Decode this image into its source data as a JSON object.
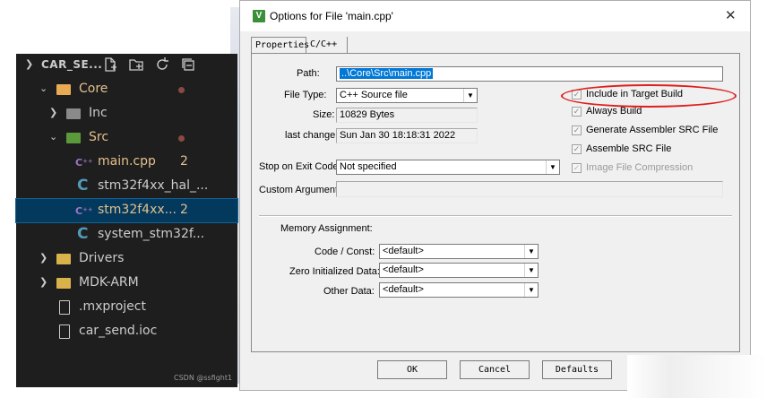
{
  "explorer": {
    "header_title": "CAR_SE...",
    "toolbar_icons": [
      "new-file-icon",
      "new-folder-icon",
      "refresh-icon",
      "collapse-all-icon"
    ],
    "items": [
      {
        "label": "Core",
        "type": "folder",
        "expanded": true,
        "depth": 1,
        "color": "#e8ab53"
      },
      {
        "label": "Inc",
        "type": "folder",
        "expanded": false,
        "depth": 2,
        "color": "#8a8a8a"
      },
      {
        "label": "Src",
        "type": "folder",
        "expanded": true,
        "depth": 2,
        "color": "#5b9a3a"
      },
      {
        "label": "main.cpp",
        "type": "cpp",
        "badge": "2",
        "depth": 3
      },
      {
        "label": "stm32f4xx_hal_...",
        "type": "c",
        "depth": 3
      },
      {
        "label": "stm32f4xx...",
        "type": "cpp",
        "badge": "2",
        "depth": 3,
        "selected": true
      },
      {
        "label": "system_stm32f...",
        "type": "c",
        "depth": 3
      },
      {
        "label": "Drivers",
        "type": "folder",
        "expanded": false,
        "depth": 1,
        "color": "#d9b24c"
      },
      {
        "label": "MDK-ARM",
        "type": "folder",
        "expanded": false,
        "depth": 1,
        "color": "#d9b24c"
      },
      {
        "label": ".mxproject",
        "type": "file",
        "depth": 1
      },
      {
        "label": "car_send.ioc",
        "type": "file",
        "depth": 1
      }
    ],
    "watermark": "CSDN @ssfight1",
    "colors": {
      "background": "#1e1e1e",
      "text": "#cccccc",
      "modified": "#e2c08d",
      "selection": "#04395e"
    }
  },
  "dialog": {
    "title": "Options for File 'main.cpp'",
    "close_glyph": "✕",
    "app_icon_glyph": "V",
    "tabs": [
      "Properties",
      "C/C++"
    ],
    "labels": {
      "path": "Path:",
      "file_type": "File Type:",
      "size": "Size:",
      "last_change": "last change:",
      "stop_on_exit": "Stop on Exit Code:",
      "custom_args": "Custom Arguments:",
      "memory_assignment": "Memory Assignment:",
      "code_const": "Code / Const:",
      "zero_init": "Zero Initialized Data:",
      "other_data": "Other Data:"
    },
    "values": {
      "path": "..\\Core\\Src\\main.cpp",
      "file_type": "C++ Source file",
      "size": "10829 Bytes",
      "last_change": "Sun Jan 30 18:18:31 2022",
      "stop_on_exit": "Not specified",
      "custom_args": "",
      "code_const": "<default>",
      "zero_init": "<default>",
      "other_data": "<default>"
    },
    "checkboxes": [
      {
        "label": "Include in Target Build",
        "checked": true,
        "enabled": true
      },
      {
        "label": "Always Build",
        "checked": true,
        "enabled": true
      },
      {
        "label": "Generate Assembler SRC File",
        "checked": true,
        "enabled": true
      },
      {
        "label": "Assemble SRC File",
        "checked": true,
        "enabled": true
      },
      {
        "label": "Image File Compression",
        "checked": true,
        "enabled": false
      }
    ],
    "buttons": {
      "ok": "OK",
      "cancel": "Cancel",
      "defaults": "Defaults"
    },
    "annotation_color": "#e01e1e"
  }
}
